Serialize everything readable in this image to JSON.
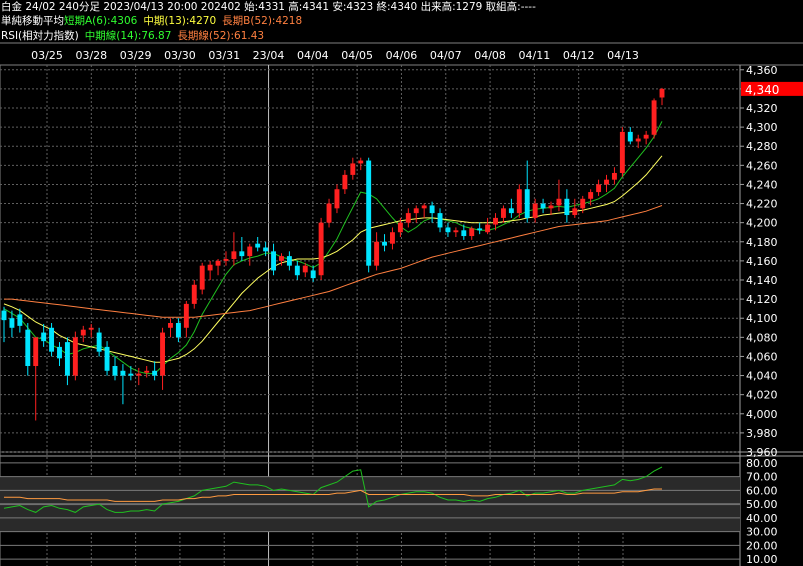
{
  "header": {
    "line1": "白金 24/02 240分足 2023/04/13 20:00 202402 始:4331 高:4341 安:4323 終:4340 出来高:1279 取組高:----",
    "ma_title": "単純移動平均",
    "ma_short": "短期A(6):4306",
    "ma_mid": "中期(13):4270",
    "ma_long": "長期B(52):4218",
    "rsi_title": "RSI(相対力指数)",
    "rsi_mid": "中期線(14):76.87",
    "rsi_long": "長期線(52):61.43"
  },
  "colors": {
    "up": "#ff2020",
    "down": "#00e5ff",
    "ma_short": "#20c020",
    "ma_mid": "#ffff60",
    "ma_long": "#ff7f40",
    "rsi_mid": "#20c020",
    "rsi_long": "#ff9a40",
    "grid": "#606060",
    "current_price_bg": "#ff0000",
    "header_green": "#30ff30",
    "header_yellow": "#ffff40",
    "header_orange": "#ff8040"
  },
  "chart_data": {
    "type": "candlestick",
    "dates": [
      "03/25",
      "03/28",
      "03/29",
      "03/30",
      "03/31",
      "23/04",
      "04/04",
      "04/05",
      "04/06",
      "04/07",
      "04/08",
      "04/11",
      "04/12",
      "04/13"
    ],
    "price_ticks": [
      4360,
      4340,
      4320,
      4300,
      4280,
      4260,
      4240,
      4220,
      4200,
      4180,
      4160,
      4140,
      4120,
      4100,
      4080,
      4060,
      4040,
      4020,
      4000,
      3980,
      3960
    ],
    "price_ylim": [
      3960,
      4365
    ],
    "current_price": "4,340",
    "rsi_ticks": [
      "80.00",
      "70.00",
      "60.00",
      "50.00",
      "40.00",
      "30.00",
      "20.00",
      "10.00"
    ],
    "rsi_ylim": [
      5,
      85
    ],
    "candles": [
      {
        "o": 4108,
        "h": 4112,
        "l": 4075,
        "c": 4098
      },
      {
        "o": 4100,
        "h": 4108,
        "l": 4080,
        "c": 4090
      },
      {
        "o": 4104,
        "h": 4110,
        "l": 4085,
        "c": 4092
      },
      {
        "o": 4088,
        "h": 4095,
        "l": 4040,
        "c": 4050
      },
      {
        "o": 4050,
        "h": 4060,
        "l": 3993,
        "c": 4080
      },
      {
        "o": 4085,
        "h": 4094,
        "l": 4070,
        "c": 4076
      },
      {
        "o": 4090,
        "h": 4095,
        "l": 4060,
        "c": 4065
      },
      {
        "o": 4070,
        "h": 4075,
        "l": 4050,
        "c": 4058
      },
      {
        "o": 4075,
        "h": 4080,
        "l": 4030,
        "c": 4040
      },
      {
        "o": 4040,
        "h": 4086,
        "l": 4035,
        "c": 4080
      },
      {
        "o": 4082,
        "h": 4092,
        "l": 4075,
        "c": 4088
      },
      {
        "o": 4088,
        "h": 4094,
        "l": 4080,
        "c": 4090
      },
      {
        "o": 4085,
        "h": 4090,
        "l": 4060,
        "c": 4065
      },
      {
        "o": 4070,
        "h": 4076,
        "l": 4040,
        "c": 4045
      },
      {
        "o": 4050,
        "h": 4060,
        "l": 4035,
        "c": 4040
      },
      {
        "o": 4045,
        "h": 4052,
        "l": 4010,
        "c": 4040
      },
      {
        "o": 4042,
        "h": 4050,
        "l": 4035,
        "c": 4040
      },
      {
        "o": 4040,
        "h": 4048,
        "l": 4030,
        "c": 4042
      },
      {
        "o": 4043,
        "h": 4050,
        "l": 4038,
        "c": 4045
      },
      {
        "o": 4045,
        "h": 4055,
        "l": 4035,
        "c": 4040
      },
      {
        "o": 4040,
        "h": 4090,
        "l": 4025,
        "c": 4085
      },
      {
        "o": 4090,
        "h": 4100,
        "l": 4080,
        "c": 4095
      },
      {
        "o": 4095,
        "h": 4100,
        "l": 4075,
        "c": 4080
      },
      {
        "o": 4090,
        "h": 4118,
        "l": 4080,
        "c": 4115
      },
      {
        "o": 4115,
        "h": 4140,
        "l": 4110,
        "c": 4135
      },
      {
        "o": 4130,
        "h": 4158,
        "l": 4125,
        "c": 4155
      },
      {
        "o": 4150,
        "h": 4160,
        "l": 4140,
        "c": 4156
      },
      {
        "o": 4155,
        "h": 4162,
        "l": 4145,
        "c": 4160
      },
      {
        "o": 4160,
        "h": 4170,
        "l": 4155,
        "c": 4162
      },
      {
        "o": 4162,
        "h": 4190,
        "l": 4155,
        "c": 4170
      },
      {
        "o": 4170,
        "h": 4185,
        "l": 4160,
        "c": 4165
      },
      {
        "o": 4165,
        "h": 4178,
        "l": 4155,
        "c": 4175
      },
      {
        "o": 4178,
        "h": 4185,
        "l": 4170,
        "c": 4174
      },
      {
        "o": 4174,
        "h": 4180,
        "l": 4165,
        "c": 4170
      },
      {
        "o": 4170,
        "h": 4178,
        "l": 4145,
        "c": 4150
      },
      {
        "o": 4160,
        "h": 4168,
        "l": 4155,
        "c": 4165
      },
      {
        "o": 4165,
        "h": 4170,
        "l": 4150,
        "c": 4155
      },
      {
        "o": 4155,
        "h": 4160,
        "l": 4140,
        "c": 4145
      },
      {
        "o": 4148,
        "h": 4158,
        "l": 4143,
        "c": 4155
      },
      {
        "o": 4150,
        "h": 4155,
        "l": 4138,
        "c": 4142
      },
      {
        "o": 4145,
        "h": 4205,
        "l": 4140,
        "c": 4200
      },
      {
        "o": 4200,
        "h": 4225,
        "l": 4195,
        "c": 4220
      },
      {
        "o": 4215,
        "h": 4240,
        "l": 4210,
        "c": 4235
      },
      {
        "o": 4235,
        "h": 4255,
        "l": 4230,
        "c": 4250
      },
      {
        "o": 4250,
        "h": 4268,
        "l": 4245,
        "c": 4262
      },
      {
        "o": 4262,
        "h": 4268,
        "l": 4255,
        "c": 4265
      },
      {
        "o": 4265,
        "h": 4268,
        "l": 4148,
        "c": 4155
      },
      {
        "o": 4155,
        "h": 4190,
        "l": 4150,
        "c": 4180
      },
      {
        "o": 4180,
        "h": 4188,
        "l": 4170,
        "c": 4176
      },
      {
        "o": 4178,
        "h": 4195,
        "l": 4172,
        "c": 4190
      },
      {
        "o": 4190,
        "h": 4205,
        "l": 4185,
        "c": 4200
      },
      {
        "o": 4200,
        "h": 4215,
        "l": 4195,
        "c": 4210
      },
      {
        "o": 4210,
        "h": 4218,
        "l": 4200,
        "c": 4215
      },
      {
        "o": 4215,
        "h": 4220,
        "l": 4205,
        "c": 4218
      },
      {
        "o": 4218,
        "h": 4222,
        "l": 4200,
        "c": 4210
      },
      {
        "o": 4210,
        "h": 4215,
        "l": 4190,
        "c": 4195
      },
      {
        "o": 4195,
        "h": 4200,
        "l": 4185,
        "c": 4190
      },
      {
        "o": 4190,
        "h": 4195,
        "l": 4185,
        "c": 4192
      },
      {
        "o": 4192,
        "h": 4198,
        "l": 4182,
        "c": 4186
      },
      {
        "o": 4186,
        "h": 4196,
        "l": 4182,
        "c": 4194
      },
      {
        "o": 4194,
        "h": 4200,
        "l": 4188,
        "c": 4192
      },
      {
        "o": 4190,
        "h": 4205,
        "l": 4188,
        "c": 4198
      },
      {
        "o": 4198,
        "h": 4210,
        "l": 4192,
        "c": 4205
      },
      {
        "o": 4205,
        "h": 4218,
        "l": 4200,
        "c": 4215
      },
      {
        "o": 4215,
        "h": 4225,
        "l": 4205,
        "c": 4210
      },
      {
        "o": 4210,
        "h": 4240,
        "l": 4205,
        "c": 4235
      },
      {
        "o": 4235,
        "h": 4265,
        "l": 4200,
        "c": 4205
      },
      {
        "o": 4205,
        "h": 4225,
        "l": 4200,
        "c": 4220
      },
      {
        "o": 4220,
        "h": 4225,
        "l": 4210,
        "c": 4215
      },
      {
        "o": 4215,
        "h": 4222,
        "l": 4208,
        "c": 4218
      },
      {
        "o": 4218,
        "h": 4245,
        "l": 4212,
        "c": 4225
      },
      {
        "o": 4225,
        "h": 4235,
        "l": 4200,
        "c": 4208
      },
      {
        "o": 4208,
        "h": 4225,
        "l": 4205,
        "c": 4215
      },
      {
        "o": 4215,
        "h": 4228,
        "l": 4210,
        "c": 4225
      },
      {
        "o": 4225,
        "h": 4235,
        "l": 4218,
        "c": 4232
      },
      {
        "o": 4232,
        "h": 4245,
        "l": 4228,
        "c": 4240
      },
      {
        "o": 4240,
        "h": 4250,
        "l": 4232,
        "c": 4245
      },
      {
        "o": 4245,
        "h": 4258,
        "l": 4240,
        "c": 4252
      },
      {
        "o": 4252,
        "h": 4300,
        "l": 4248,
        "c": 4295
      },
      {
        "o": 4295,
        "h": 4300,
        "l": 4282,
        "c": 4285
      },
      {
        "o": 4285,
        "h": 4292,
        "l": 4278,
        "c": 4288
      },
      {
        "o": 4288,
        "h": 4296,
        "l": 4282,
        "c": 4292
      },
      {
        "o": 4292,
        "h": 4330,
        "l": 4288,
        "c": 4328
      },
      {
        "o": 4331,
        "h": 4341,
        "l": 4323,
        "c": 4340
      }
    ],
    "series": [
      {
        "name": "短期A(6)",
        "values": [
          4110,
          4105,
          4100,
          4090,
          4080,
          4078,
          4072,
          4068,
          4062,
          4064,
          4068,
          4070,
          4072,
          4066,
          4060,
          4054,
          4048,
          4044,
          4042,
          4042,
          4050,
          4058,
          4064,
          4072,
          4086,
          4104,
          4118,
          4132,
          4146,
          4156,
          4160,
          4163,
          4165,
          4168,
          4168,
          4164,
          4162,
          4160,
          4157,
          4153,
          4158,
          4170,
          4183,
          4200,
          4216,
          4232,
          4230,
          4225,
          4215,
          4205,
          4196,
          4190,
          4195,
          4202,
          4205,
          4204,
          4202,
          4200,
          4196,
          4194,
          4192,
          4192,
          4194,
          4198,
          4202,
          4208,
          4212,
          4214,
          4215,
          4216,
          4217,
          4216,
          4218,
          4220,
          4222,
          4225,
          4230,
          4236,
          4248,
          4258,
          4268,
          4278,
          4290,
          4306
        ]
      },
      {
        "name": "中期(13)",
        "values": [
          4115,
          4112,
          4108,
          4102,
          4096,
          4092,
          4088,
          4082,
          4078,
          4074,
          4072,
          4070,
          4068,
          4066,
          4064,
          4062,
          4060,
          4058,
          4056,
          4054,
          4054,
          4056,
          4058,
          4062,
          4068,
          4076,
          4086,
          4096,
          4106,
          4116,
          4126,
          4134,
          4142,
          4148,
          4154,
          4158,
          4160,
          4162,
          4162,
          4162,
          4163,
          4166,
          4170,
          4176,
          4182,
          4190,
          4194,
          4196,
          4198,
          4200,
          4202,
          4203,
          4204,
          4205,
          4205,
          4204,
          4203,
          4202,
          4201,
          4200,
          4200,
          4200,
          4200,
          4201,
          4202,
          4203,
          4205,
          4206,
          4208,
          4209,
          4210,
          4211,
          4212,
          4213,
          4215,
          4217,
          4219,
          4222,
          4228,
          4235,
          4242,
          4250,
          4260,
          4270
        ]
      },
      {
        "name": "長期B(52)",
        "values": [
          4120,
          4120,
          4119,
          4118,
          4117,
          4116,
          4115,
          4114,
          4113,
          4112,
          4111,
          4110,
          4109,
          4108,
          4107,
          4106,
          4105,
          4104,
          4103,
          4102,
          4101,
          4101,
          4101,
          4101,
          4101,
          4102,
          4103,
          4104,
          4105,
          4106,
          4107,
          4108,
          4110,
          4112,
          4114,
          4116,
          4118,
          4120,
          4122,
          4124,
          4126,
          4128,
          4131,
          4134,
          4137,
          4140,
          4143,
          4146,
          4148,
          4150,
          4152,
          4155,
          4158,
          4161,
          4164,
          4166,
          4168,
          4170,
          4172,
          4174,
          4176,
          4178,
          4180,
          4182,
          4184,
          4186,
          4188,
          4190,
          4192,
          4194,
          4196,
          4197,
          4198,
          4199,
          4200,
          4201,
          4202,
          4204,
          4206,
          4208,
          4210,
          4212,
          4215,
          4218
        ]
      }
    ],
    "rsi_series": [
      {
        "name": "中期線(14)",
        "values": [
          47,
          48,
          49,
          46,
          44,
          48,
          49,
          47,
          46,
          44,
          48,
          49,
          50,
          46,
          44,
          44,
          45,
          45,
          46,
          45,
          50,
          51,
          52,
          54,
          56,
          60,
          61,
          62,
          63,
          66,
          65,
          64,
          64,
          63,
          60,
          61,
          60,
          59,
          58,
          57,
          62,
          64,
          66,
          70,
          74,
          75,
          48,
          52,
          53,
          55,
          57,
          58,
          59,
          59,
          58,
          55,
          53,
          53,
          52,
          53,
          52,
          54,
          55,
          57,
          58,
          60,
          56,
          58,
          58,
          59,
          60,
          58,
          58,
          60,
          61,
          62,
          63,
          64,
          68,
          67,
          68,
          70,
          74,
          77
        ]
      },
      {
        "name": "長期線(52)",
        "values": [
          55,
          55,
          55,
          54,
          54,
          54,
          54,
          54,
          53,
          53,
          53,
          53,
          53,
          53,
          52,
          52,
          52,
          52,
          52,
          52,
          53,
          53,
          53,
          54,
          54,
          55,
          55,
          56,
          56,
          57,
          57,
          57,
          57,
          57,
          57,
          57,
          57,
          57,
          57,
          57,
          57,
          57,
          58,
          58,
          59,
          60,
          57,
          57,
          57,
          57,
          57,
          57,
          57,
          57,
          57,
          57,
          57,
          57,
          57,
          56,
          56,
          56,
          57,
          57,
          57,
          57,
          57,
          57,
          57,
          57,
          58,
          57,
          57,
          58,
          58,
          58,
          58,
          58,
          59,
          59,
          59,
          60,
          61,
          61
        ]
      }
    ]
  }
}
